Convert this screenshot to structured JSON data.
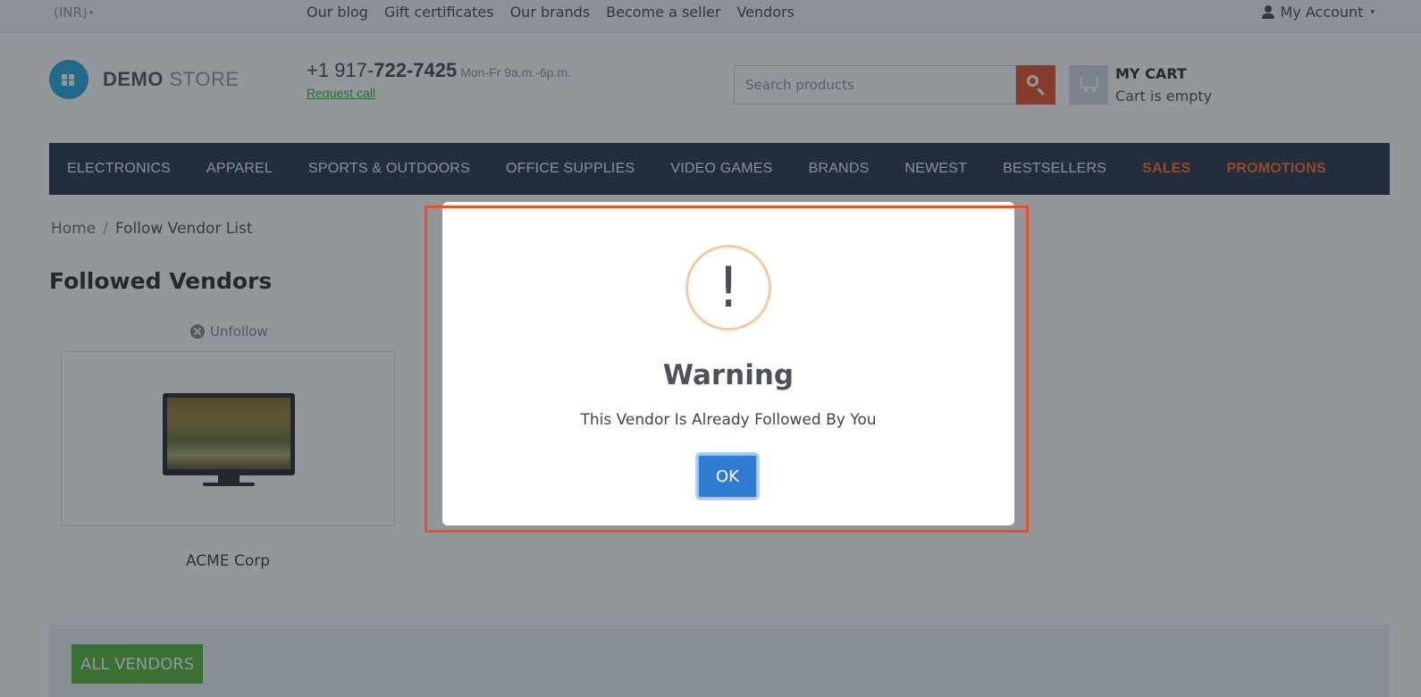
{
  "topbar": {
    "currency": "(INR)",
    "links": [
      "Our blog",
      "Gift certificates",
      "Our brands",
      "Become a seller",
      "Vendors"
    ],
    "account": "My Account"
  },
  "header": {
    "logo_bold": "DEMO",
    "logo_light": "STORE",
    "phone_prefix": "+1 917-",
    "phone_bold": "722-7425",
    "phone_hours": "Mon-Fr 9a.m.-6p.m.",
    "request_call": "Request call",
    "search_placeholder": "Search products",
    "cart_title": "MY CART",
    "cart_status": "Cart is empty"
  },
  "nav": {
    "items": [
      "ELECTRONICS",
      "APPAREL",
      "SPORTS & OUTDOORS",
      "OFFICE SUPPLIES",
      "VIDEO GAMES",
      "BRANDS",
      "NEWEST",
      "BESTSELLERS",
      "SALES",
      "PROMOTIONS"
    ]
  },
  "content": {
    "breadcrumb_home": "Home",
    "breadcrumb_sep": "/",
    "breadcrumb_current": "Follow Vendor List",
    "title": "Followed Vendors",
    "unfollow": "Unfollow",
    "vendor_name": "ACME Corp",
    "all_vendors": "ALL VENDORS"
  },
  "dialog": {
    "icon_glyph": "!",
    "title": "Warning",
    "message": "This Vendor Is Already Followed By You",
    "ok": "OK"
  },
  "colors": {
    "accent": "#e04a1e",
    "nav_bg": "#1f2b3d",
    "nav_highlight": "#f26a1e",
    "ok_button": "#2e7bd0",
    "all_vendors_button": "#4caf32",
    "highlight_border": "#e8512a"
  }
}
